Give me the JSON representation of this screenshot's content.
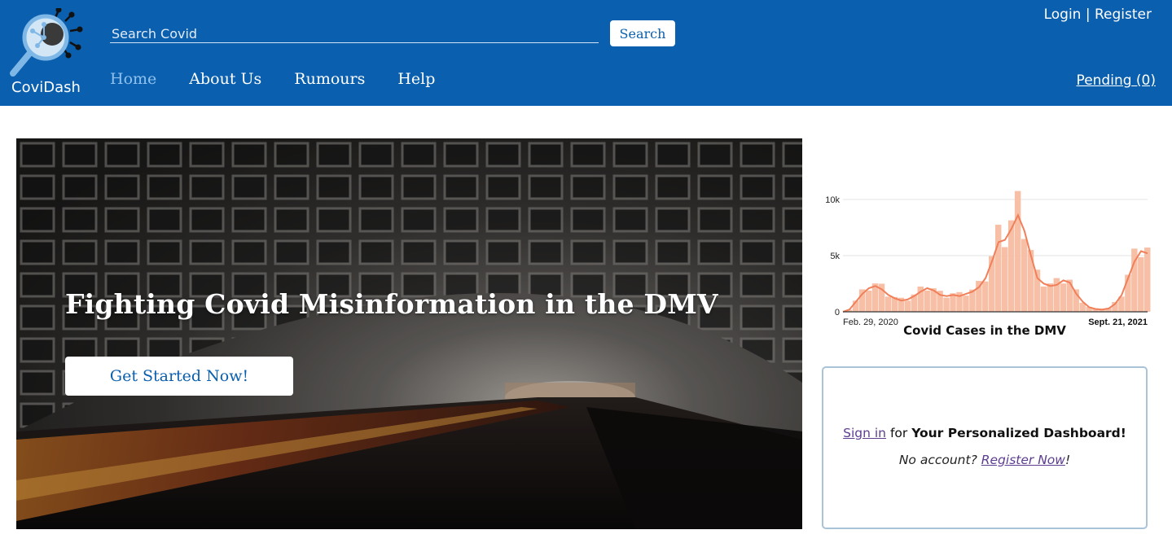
{
  "brand": {
    "name": "CoviDash",
    "icon": "magnifier-virus-icon"
  },
  "search": {
    "placeholder": "Search Covid",
    "button_label": "Search"
  },
  "auth": {
    "login": "Login",
    "separator": " | ",
    "register": "Register"
  },
  "nav": {
    "items": [
      {
        "label": "Home",
        "active": true
      },
      {
        "label": "About Us",
        "active": false
      },
      {
        "label": "Rumours",
        "active": false
      },
      {
        "label": "Help",
        "active": false
      }
    ]
  },
  "pending": {
    "label": "Pending (0)"
  },
  "hero": {
    "title": "Fighting Covid Misinformation in the DMV",
    "button_label": "Get Started Now!"
  },
  "chart_data": {
    "type": "area",
    "title": "Covid Cases in the DMV",
    "x_start_label": "Feb. 29, 2020",
    "x_end_label": "Sept. 21, 2021",
    "yticks": [
      "0",
      "5k",
      "10k"
    ],
    "ylim": [
      0,
      12000
    ],
    "grid": true,
    "color": "#f07f5a",
    "fill": "#f7c0a6",
    "series_7day": [
      0,
      200,
      900,
      1600,
      2100,
      2300,
      2000,
      1500,
      1200,
      1000,
      1100,
      1400,
      1800,
      2100,
      1900,
      1500,
      1400,
      1500,
      1400,
      1600,
      1800,
      2200,
      3000,
      4500,
      6200,
      6400,
      7400,
      8600,
      7200,
      5000,
      3000,
      2500,
      2300,
      2400,
      2800,
      2600,
      1600,
      900,
      400,
      250,
      200,
      300,
      700,
      1500,
      3000,
      4500,
      5400,
      5200
    ]
  },
  "signin_card": {
    "signin_link": "Sign in",
    "for_text": " for ",
    "dashboard_text": "Your Personalized Dashboard!",
    "no_account": "No account? ",
    "register_link": "Register Now",
    "exclaim": "!"
  },
  "colors": {
    "header": "#0a5fae",
    "accent_light": "#8fc1ee",
    "link_purple": "#5c3d8f",
    "card_border": "#a9c3d8"
  }
}
